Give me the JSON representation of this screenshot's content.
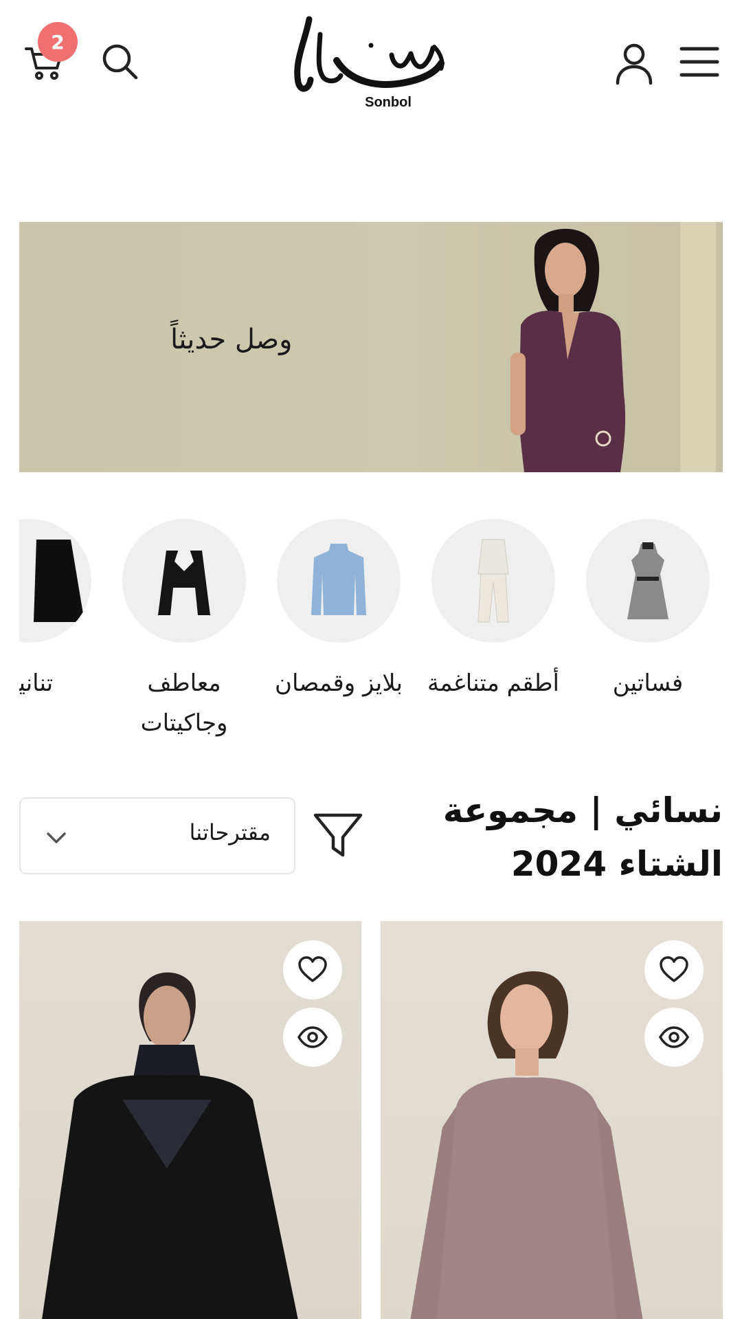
{
  "header": {
    "cart_count": "2",
    "logo_text": "سنبل",
    "logo_sub": "Sonbol",
    "icons": [
      "cart-icon",
      "search-icon",
      "user-icon",
      "menu-icon"
    ]
  },
  "hero": {
    "text": "وصل حديثاً"
  },
  "categories": [
    {
      "label": "فساتين"
    },
    {
      "label": "أطقم متناغمة"
    },
    {
      "label": "بلايز وقمصان"
    },
    {
      "label": "معاطف وجاكيتات"
    },
    {
      "label": "تنانير"
    }
  ],
  "section": {
    "title": "نسائي | مجموعة الشتاء 2024",
    "sort_value": "مقترحاتنا"
  },
  "colors": {
    "badge": "#f07070",
    "hero_bg": "#c9c6ac",
    "category_bg": "#efefef"
  }
}
